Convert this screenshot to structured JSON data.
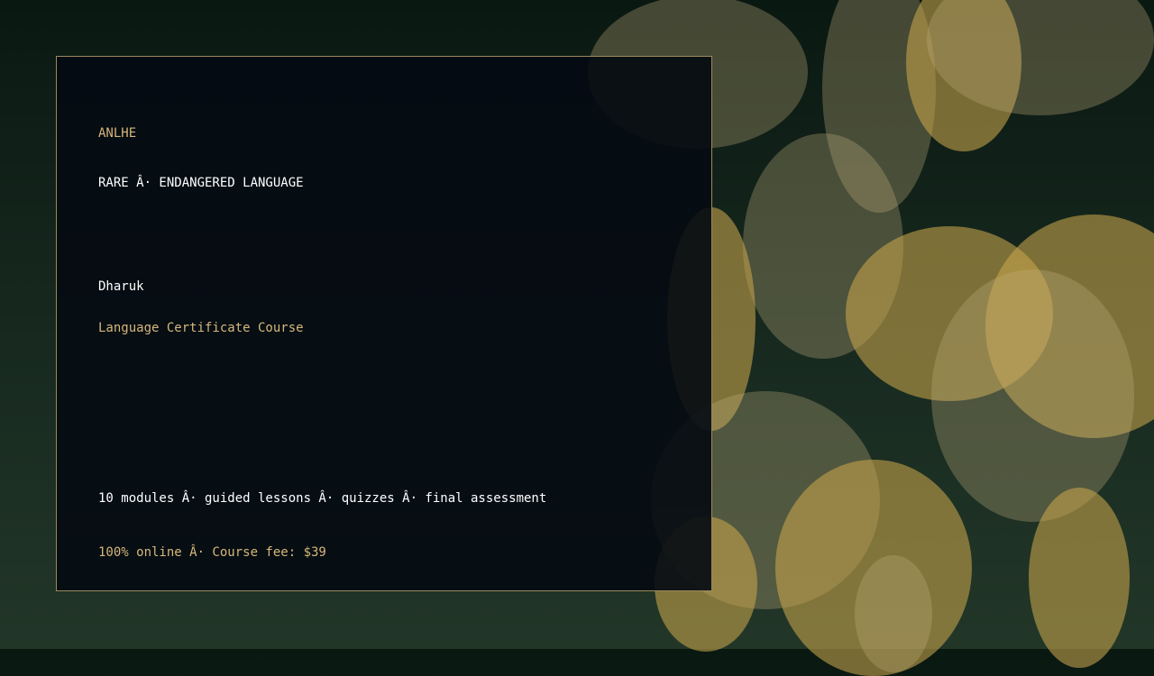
{
  "card": {
    "brand": "ANLHE",
    "tag": "RARE Â· ENDANGERED LANGUAGE",
    "language": "Dharuk",
    "course": "Language Certificate Course",
    "details": "10 modules Â· guided lessons Â· quizzes Â· final assessment",
    "fee_line": "100% online Â· Course fee: $39"
  },
  "colors": {
    "accent": "#d6b77a",
    "card_bg": "#040a12",
    "border": "#9c8a5d"
  }
}
